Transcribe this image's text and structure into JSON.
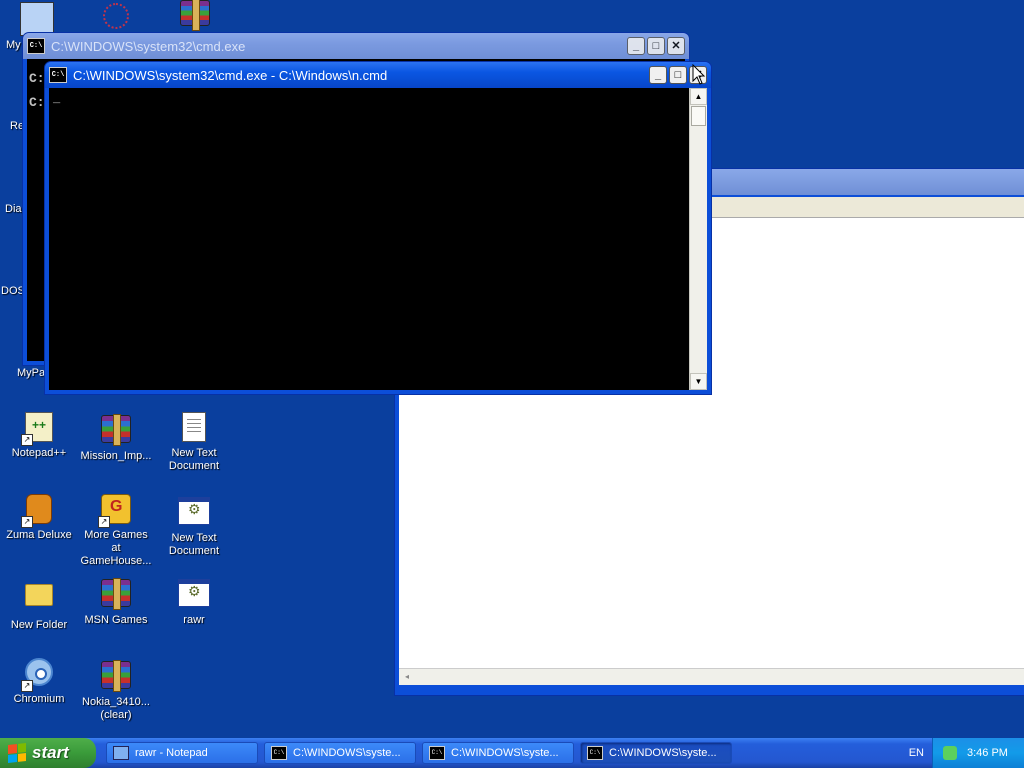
{
  "desktop": {
    "icons_partial": [
      {
        "label": "My",
        "glyph": "my-computer-icon"
      },
      {
        "label": "Re",
        "glyph": "recycle-bin-icon"
      },
      {
        "label": "Diar",
        "glyph": "folder-icon"
      },
      {
        "label": "DOS",
        "glyph": "folder-icon"
      },
      {
        "label": "MyPa",
        "glyph": "folder-icon"
      }
    ],
    "icons": [
      {
        "label": "Notepad++",
        "glyph": "notepadpp-icon"
      },
      {
        "label": "Mission_Imp...",
        "glyph": "winrar-icon"
      },
      {
        "label": "New Text Document",
        "glyph": "text-document-icon"
      },
      {
        "label": "Zuma Deluxe",
        "glyph": "zuma-icon"
      },
      {
        "label": "More Games at GameHouse...",
        "glyph": "gamehouse-icon"
      },
      {
        "label": "New Text Document",
        "glyph": "batch-file-icon"
      },
      {
        "label": "New Folder",
        "glyph": "folder-icon"
      },
      {
        "label": "MSN Games",
        "glyph": "winrar-icon"
      },
      {
        "label": "rawr",
        "glyph": "batch-file-icon"
      },
      {
        "label": "Chromium",
        "glyph": "chromium-icon"
      },
      {
        "label": "Nokia_3410... (clear)",
        "glyph": "winrar-icon"
      }
    ]
  },
  "windows": {
    "cmd_back": {
      "title": "C:\\WINDOWS\\system32\\cmd.exe",
      "lines": [
        "C:",
        "C:"
      ]
    },
    "cmd_front": {
      "title": "C:\\WINDOWS\\system32\\cmd.exe - C:\\Windows\\n.cmd",
      "cursor": "_"
    }
  },
  "taskbar": {
    "start_label": "start",
    "items": [
      {
        "label": "rawr - Notepad",
        "icon": "notepad-icon",
        "active": false
      },
      {
        "label": "C:\\WINDOWS\\syste...",
        "icon": "cmd-icon",
        "active": false
      },
      {
        "label": "C:\\WINDOWS\\syste...",
        "icon": "cmd-icon",
        "active": false
      },
      {
        "label": "C:\\WINDOWS\\syste...",
        "icon": "cmd-icon",
        "active": true
      }
    ],
    "language": "EN",
    "clock": "3:46 PM"
  },
  "colors": {
    "desktop_bg": "#0a3f9e",
    "title_active": "#0a56e2",
    "title_inactive": "#7b9ae0",
    "console_bg": "#000000",
    "start_green": "#3a9b3a"
  }
}
